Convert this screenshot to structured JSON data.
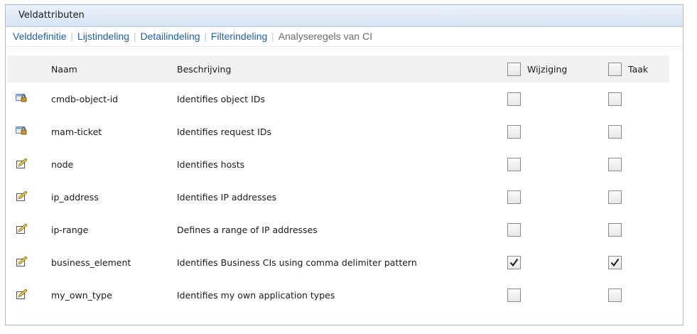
{
  "panel": {
    "title": "Veldattributen"
  },
  "tabs": [
    {
      "label": "Velddefinitie",
      "active": false
    },
    {
      "label": "Lijstindeling",
      "active": false
    },
    {
      "label": "Detailindeling",
      "active": false
    },
    {
      "label": "Filterindeling",
      "active": false
    },
    {
      "label": "Analyseregels van CI",
      "active": true
    }
  ],
  "table": {
    "headers": {
      "name": "Naam",
      "description": "Beschrijving",
      "change": "Wijziging",
      "task": "Taak"
    },
    "header_checks": {
      "change": false,
      "task": false
    },
    "rows": [
      {
        "icon": "locked-field-icon",
        "name": "cmdb-object-id",
        "description": "Identifies object IDs",
        "change": false,
        "task": false
      },
      {
        "icon": "locked-field-icon",
        "name": "mam-ticket",
        "description": "Identifies request IDs",
        "change": false,
        "task": false
      },
      {
        "icon": "pencil-edit-icon",
        "name": "node",
        "description": "Identifies hosts",
        "change": false,
        "task": false
      },
      {
        "icon": "pencil-edit-icon",
        "name": "ip_address",
        "description": "Identifies IP addresses",
        "change": false,
        "task": false
      },
      {
        "icon": "pencil-edit-icon",
        "name": "ip-range",
        "description": "Defines a range of IP addresses",
        "change": false,
        "task": false
      },
      {
        "icon": "pencil-edit-icon",
        "name": "business_element",
        "description": "Identifies Business CIs using comma delimiter pattern",
        "change": true,
        "task": true
      },
      {
        "icon": "pencil-edit-icon",
        "name": "my_own_type",
        "description": "Identifies my own application types",
        "change": false,
        "task": false
      }
    ]
  },
  "colors": {
    "link": "#1f5fa8",
    "active_tab": "#6b6b6b",
    "title_bar": "#dfe8f5",
    "header_row": "#f1f1f1"
  }
}
